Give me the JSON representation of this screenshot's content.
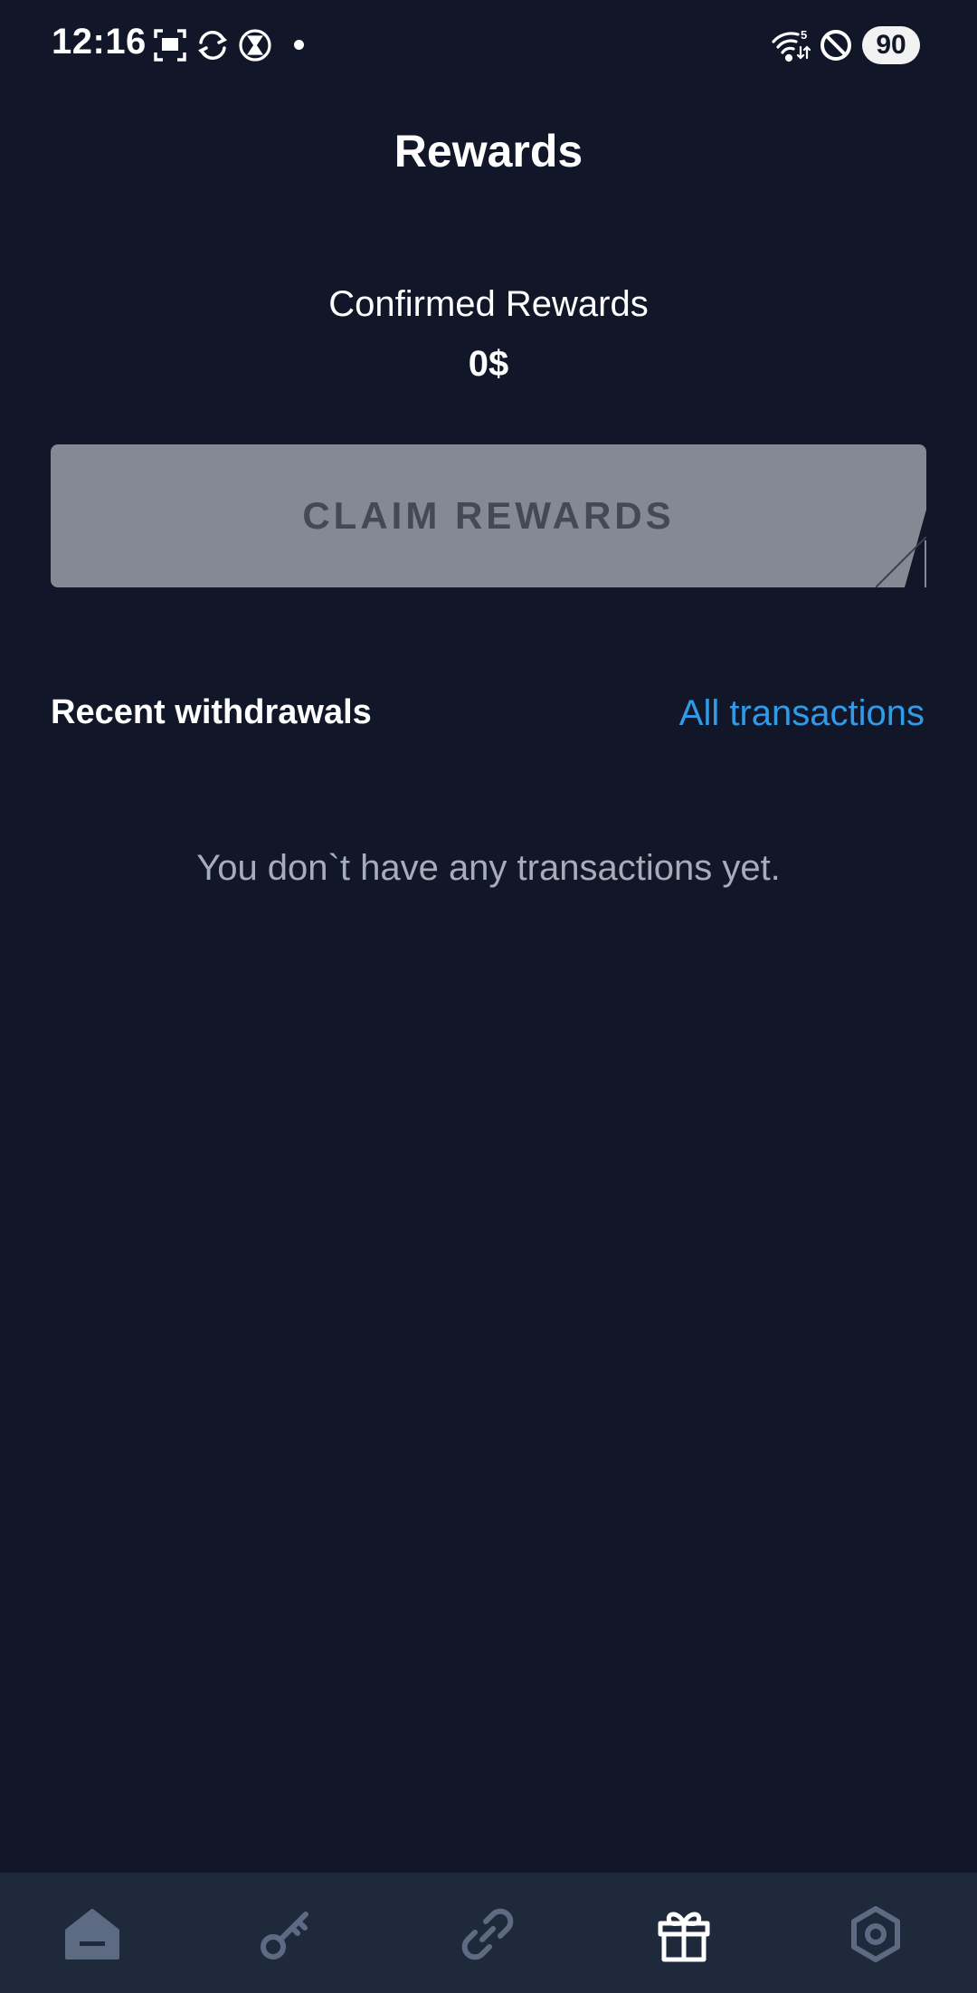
{
  "status_bar": {
    "time": "12:16",
    "battery": "90",
    "icons": [
      "screenshot-icon",
      "sync-icon",
      "hourglass-icon",
      "notification-dot",
      "wifi-icon",
      "do-not-disturb-icon",
      "battery-icon"
    ]
  },
  "header": {
    "title": "Rewards"
  },
  "rewards": {
    "confirmed_label": "Confirmed Rewards",
    "confirmed_value": "0$",
    "claim_button_label": "CLAIM REWARDS"
  },
  "withdrawals": {
    "section_title": "Recent withdrawals",
    "all_transactions_link": "All transactions",
    "empty_message": "You don`t have any transactions yet."
  },
  "bottom_nav": {
    "items": [
      {
        "icon": "home-icon",
        "active": false
      },
      {
        "icon": "key-icon",
        "active": false
      },
      {
        "icon": "link-icon",
        "active": false
      },
      {
        "icon": "gift-icon",
        "active": true
      },
      {
        "icon": "settings-icon",
        "active": false
      }
    ]
  },
  "colors": {
    "background": "#111729",
    "nav_background": "#1e293b",
    "accent_link": "#2f9be9",
    "button_disabled": "#858993",
    "nav_inactive": "#5d6b82",
    "nav_active": "#ffffff"
  }
}
